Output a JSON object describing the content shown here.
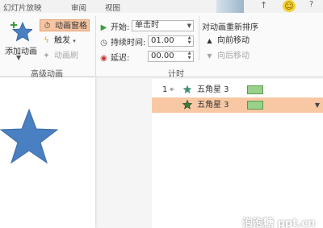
{
  "tabs": [
    {
      "label": "幻灯片放映"
    },
    {
      "label": "审阅"
    },
    {
      "label": "视图"
    }
  ],
  "ribbon": {
    "advanced_animation": {
      "add_animation_label": "添加动画",
      "animation_pane_label": "动画窗格",
      "trigger_label": "触发",
      "animation_painter_label": "动画刷",
      "group_label": "高级动画"
    },
    "timing": {
      "start_label": "开始:",
      "start_value": "单击时",
      "duration_label": "持续时间:",
      "duration_value": "01.00",
      "delay_label": "延迟:",
      "delay_value": "00.00",
      "reorder_title": "对动画重新排序",
      "move_earlier_label": "向前移动",
      "move_later_label": "向后移动",
      "group_label": "计时"
    }
  },
  "animation_pane": {
    "items": [
      {
        "index": "1",
        "name": "五角星 3",
        "selected": false
      },
      {
        "index": "",
        "name": "五角星 3",
        "selected": true
      }
    ]
  },
  "colors": {
    "accent_selected": "#f8c8a4",
    "star_blue": "#4a7fc1",
    "timeline_bar": "#9ad18a",
    "effect_green": "#3f7d3a"
  },
  "icons": [
    "star-add-icon",
    "animation-pane-icon",
    "trigger-icon",
    "animation-painter-icon",
    "play-icon",
    "clock-icon",
    "delay-icon",
    "up-arrow-icon",
    "down-arrow-icon",
    "mouse-icon",
    "star-icon",
    "smiley-icon",
    "help-icon"
  ],
  "watermark": "泡泡糖 ppt.cn"
}
